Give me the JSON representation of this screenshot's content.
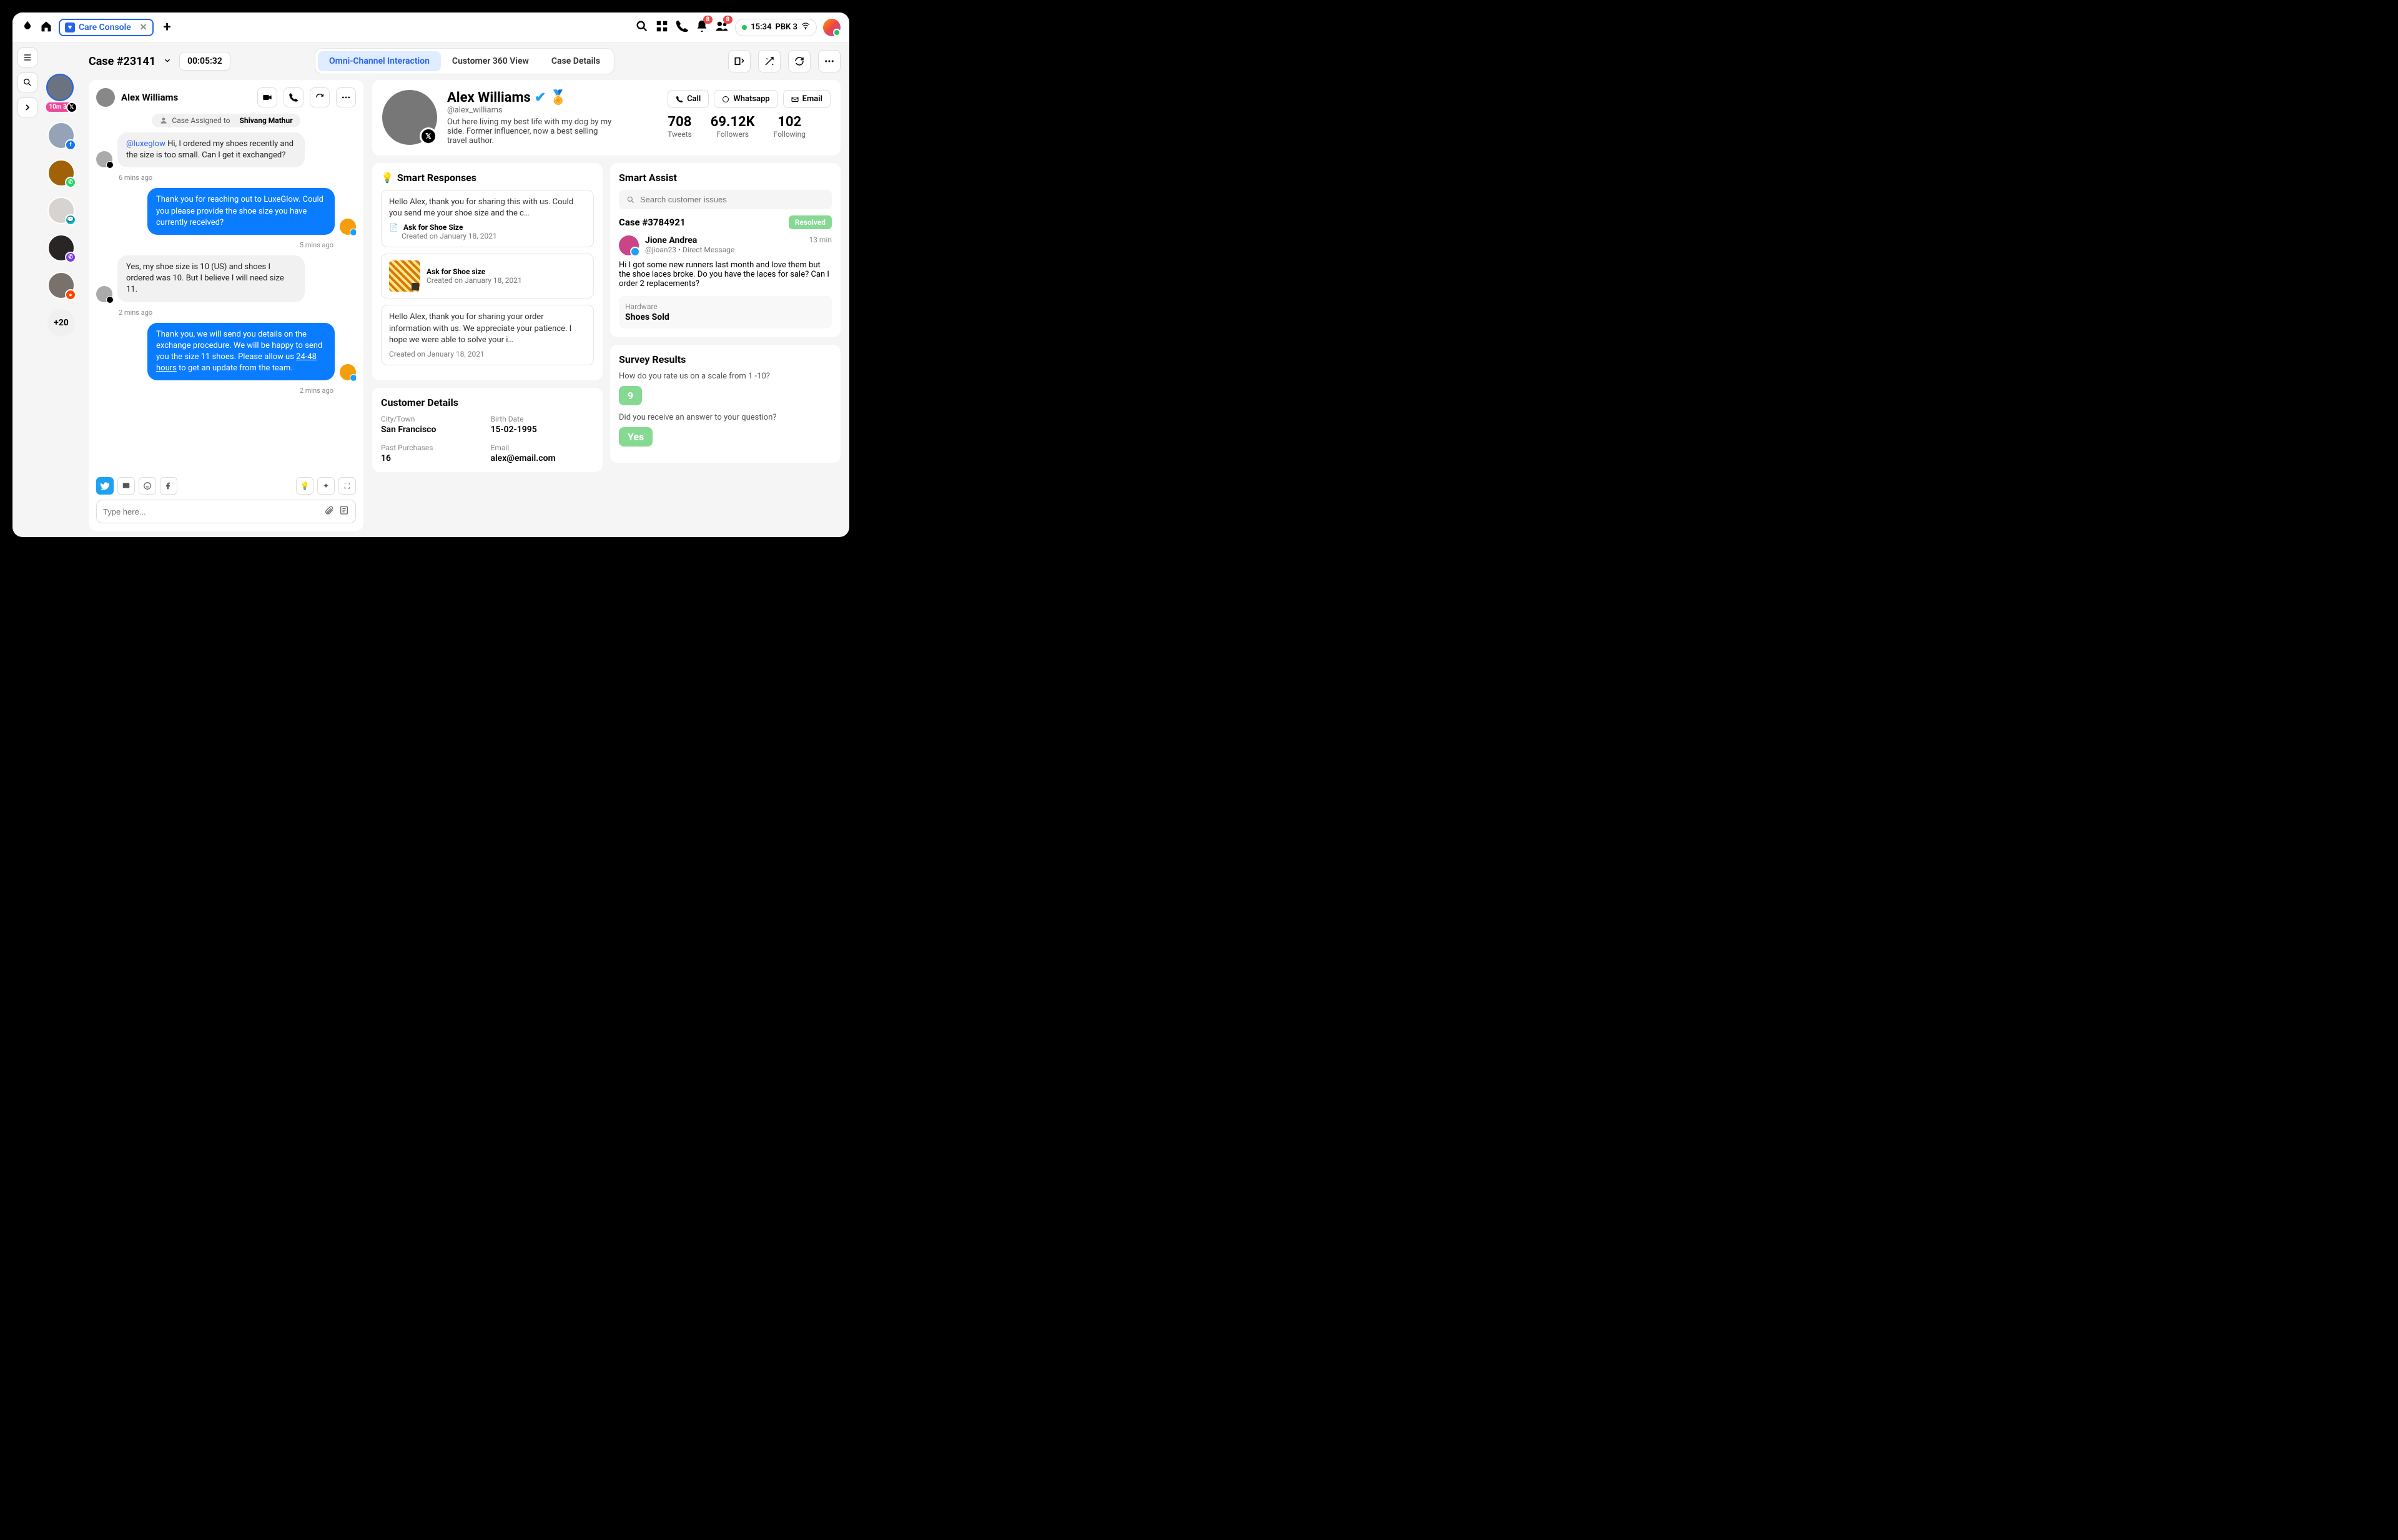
{
  "topbar": {
    "tab_label": "Care Console",
    "time": "15:34",
    "status_label": "PBK 3",
    "notif_badge": "8",
    "people_badge": "8"
  },
  "subheader": {
    "case_title": "Case #23141",
    "timer": "00:05:32",
    "tabs": [
      "Omni-Channel Interaction",
      "Customer 360 View",
      "Case Details"
    ]
  },
  "queue": {
    "timer": "10m 32s",
    "more": "+20"
  },
  "chat": {
    "name": "Alex Williams",
    "assigned_prefix": "Case Assigned to",
    "assigned_to": "Shivang Mathur",
    "messages": [
      {
        "dir": "in",
        "mention": "@luxeglow",
        "text": " Hi, I ordered my shoes recently and the size is too small. Can I get it exchanged?",
        "time": "6 mins ago"
      },
      {
        "dir": "out",
        "text": "Thank you for reaching out to LuxeGlow. Could you please provide the shoe size you have currently received?",
        "time": "5 mins ago"
      },
      {
        "dir": "in",
        "text": "Yes, my shoe size is 10 (US) and shoes I ordered was 10. But I believe I will need size 11.",
        "time": "2 mins ago"
      },
      {
        "dir": "out",
        "text": "Thank you, we will send you details on the exchange procedure. We will be happy to send you the size 11 shoes. Please allow us ",
        "link": "24-48 hours",
        "text2": " to get an update from the team.",
        "time": "2 mins ago"
      }
    ],
    "placeholder": "Type here..."
  },
  "profile": {
    "name": "Alex Williams",
    "handle": "@alex_williams",
    "bio": "Out here living my best life with my dog by my side. Former influencer, now a best selling travel author.",
    "btns": {
      "call": "Call",
      "whatsapp": "Whatsapp",
      "email": "Email"
    },
    "stats": [
      {
        "num": "708",
        "lbl": "Tweets"
      },
      {
        "num": "69.12K",
        "lbl": "Followers"
      },
      {
        "num": "102",
        "lbl": "Following"
      }
    ]
  },
  "smart_responses": {
    "title": "Smart Responses",
    "items": [
      {
        "text": "Hello Alex, thank you for sharing this with us. Could you send me your shoe size and the c…",
        "title": "Ask for Shoe Size",
        "date": "Created on January 18, 2021",
        "thumb": false
      },
      {
        "text": "",
        "title": "Ask for Shoe size",
        "date": "Created on January 18, 2021",
        "thumb": true
      },
      {
        "text": "Hello Alex, thank you for sharing your order information with us. We appreciate your patience. I hope we were able to solve your i…",
        "title": "",
        "date": "Created on January 18, 2021",
        "thumb": false
      }
    ]
  },
  "smart_assist": {
    "title": "Smart Assist",
    "search_placeholder": "Search customer issues",
    "case_id": "Case #3784921",
    "status": "Resolved",
    "user_name": "Jione Andrea",
    "user_handle": "@jioan23 • Direct Message",
    "time": "13 min",
    "text": "Hi I got some new runners last month and love them but the shoe laces broke. Do you have the laces for sale? Can I order 2 replacements?",
    "tag_lbl": "Hardware",
    "tag_val": "Shoes Sold"
  },
  "customer_details": {
    "title": "Customer Details",
    "fields": [
      {
        "lbl": "City/Town",
        "val": "San Francisco"
      },
      {
        "lbl": "Birth Date",
        "val": "15-02-1995"
      },
      {
        "lbl": "Past Purchases",
        "val": "16"
      },
      {
        "lbl": "Email",
        "val": "alex@email.com"
      }
    ]
  },
  "survey": {
    "title": "Survey Results",
    "q1": "How do you rate us on a scale from 1 -10?",
    "a1": "9",
    "q2": "Did you receive an answer to your question?",
    "a2": "Yes"
  }
}
